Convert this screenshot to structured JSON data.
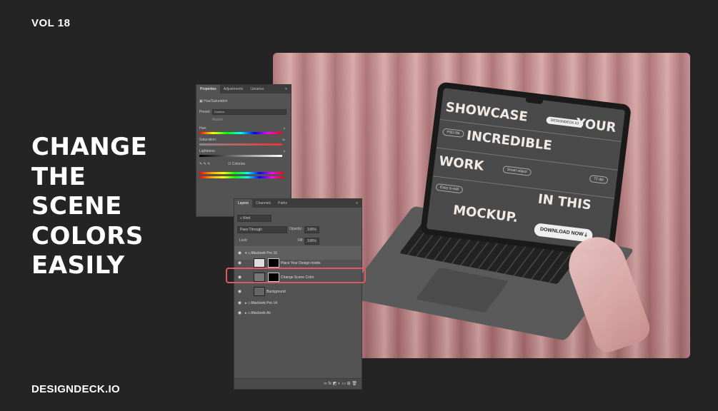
{
  "volume": "VOL 18",
  "headline": [
    "CHANGE",
    "THE",
    "SCENE",
    "COLORS",
    "EASILY"
  ],
  "brand": "DESIGNDECK.IO",
  "mockup": {
    "lines": [
      "SHOWCASE",
      "YOUR",
      "INCREDIBLE",
      "WORK",
      "IN THIS",
      "MOCKUP."
    ],
    "badge": "DESIGNDECK.IO",
    "pills": [
      "PSD file",
      "72 dpi",
      "Smart object",
      "Easy to edit"
    ],
    "download": "DOWNLOAD NOW"
  },
  "properties_panel": {
    "tabs": [
      "Properties",
      "Adjustments",
      "Libraries"
    ],
    "title": "Hue/Saturation",
    "preset_label": "Preset:",
    "preset_value": "Custom",
    "master": "Master",
    "hue_label": "Hue:",
    "hue_value": "0",
    "saturation_label": "Saturation:",
    "saturation_value": "25",
    "lightness_label": "Lightness:",
    "lightness_value": "0",
    "colorize": "Colorize"
  },
  "layers_panel": {
    "tabs": [
      "Layers",
      "Channels",
      "Paths"
    ],
    "kind": "Kind",
    "blend": "Pass Through",
    "opacity_label": "Opacity:",
    "opacity_value": "100%",
    "lock_label": "Lock:",
    "fill_label": "Fill:",
    "fill_value": "100%",
    "layers": [
      "Macbook Pro 16",
      "Place Your Design Inside",
      "Change Scene Color",
      "Background",
      "Macbook Pro 14",
      "Macbook Air"
    ],
    "footer": "fx"
  },
  "colors": {
    "highlight": "#e0595e",
    "background": "#242424",
    "curtain": "#c48d8e"
  }
}
